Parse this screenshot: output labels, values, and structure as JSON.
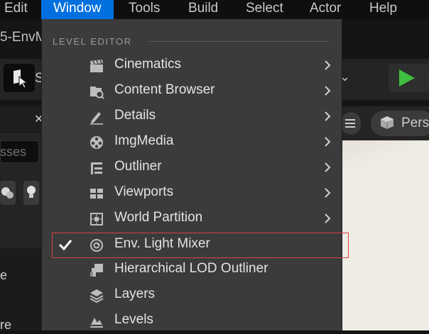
{
  "menubar": {
    "items": [
      {
        "label": "Edit"
      },
      {
        "label": "Window",
        "active": true
      },
      {
        "label": "Tools"
      },
      {
        "label": "Build"
      },
      {
        "label": "Select"
      },
      {
        "label": "Actor"
      },
      {
        "label": "Help"
      }
    ]
  },
  "background": {
    "title_fragment": "5-EnvM",
    "mode_letter": "S",
    "search_placeholder_fragment": "sses",
    "viewport_mode": "Pers",
    "panel_text_1": "e",
    "panel_text_2": "re"
  },
  "window_menu": {
    "section": "LEVEL EDITOR",
    "items": [
      {
        "label": "Cinematics",
        "icon": "clapperboard-icon",
        "submenu": true
      },
      {
        "label": "Content Browser",
        "icon": "folder-search-icon",
        "submenu": true
      },
      {
        "label": "Details",
        "icon": "pencil-details-icon",
        "submenu": true
      },
      {
        "label": "ImgMedia",
        "icon": "film-reel-icon",
        "submenu": true
      },
      {
        "label": "Outliner",
        "icon": "outliner-icon",
        "submenu": true
      },
      {
        "label": "Viewports",
        "icon": "viewports-grid-icon",
        "submenu": true
      },
      {
        "label": "World Partition",
        "icon": "world-partition-icon",
        "submenu": true
      },
      {
        "label": "Env. Light Mixer",
        "icon": "light-mixer-icon",
        "submenu": false,
        "checked": true,
        "highlighted": true
      },
      {
        "label": "Hierarchical LOD Outliner",
        "icon": "hlod-icon",
        "submenu": false
      },
      {
        "label": "Layers",
        "icon": "layers-icon",
        "submenu": false
      },
      {
        "label": "Levels",
        "icon": "levels-icon",
        "submenu": false
      }
    ]
  },
  "colors": {
    "menu_bg": "#3b3b3b",
    "active_menu": "#0070e0",
    "highlight_outline": "#d94040",
    "play_green": "#3fbf3f"
  }
}
